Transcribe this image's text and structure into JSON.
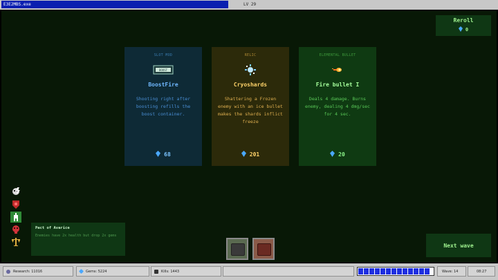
{
  "window": {
    "title": "E3E2MBS.exe",
    "level": "LV 29"
  },
  "reroll": {
    "label": "Reroll",
    "count": "0"
  },
  "cards": [
    {
      "type": "SLOT MOD",
      "name": "BoostFire",
      "description": "Shooting right after boosting refills the boost container.",
      "cost": "68",
      "icon": "chip-icon"
    },
    {
      "type": "RELIC",
      "name": "Cryoshards",
      "description": "Shattering a Frozen enemy with an ice bullet makes the shards inflict freeze",
      "cost": "201",
      "icon": "ice-crystal-icon"
    },
    {
      "type": "ELEMENTAL BULLET",
      "name": "Fire bullet I",
      "description": "Deals 4 damage. Burns enemy, dealing 4 dmg/sec for 4 sec.",
      "cost": "20",
      "icon": "fire-bullet-icon"
    }
  ],
  "pact": {
    "title": "Pact of Avarice",
    "description": "Enemies have 2x health but drop 2x gems"
  },
  "side_icons": [
    "skull-bolt-icon",
    "red-shield-icon",
    "green-figure-icon",
    "red-skull-icon",
    "gold-scale-icon"
  ],
  "buttons": {
    "next_wave": "Next wave"
  },
  "status": {
    "research": "Research: 11016",
    "gems": "Gems: 5224",
    "kills": "Kills: 1443",
    "wave": "Wave: 14",
    "time": "08:27",
    "wave_progress": 1.0
  },
  "colors": {
    "background": "#081806",
    "slot_mod": "#6fb8ff",
    "relic": "#ffd36a",
    "elemental": "#a6ff9c",
    "gem": "#4aa8ff"
  }
}
